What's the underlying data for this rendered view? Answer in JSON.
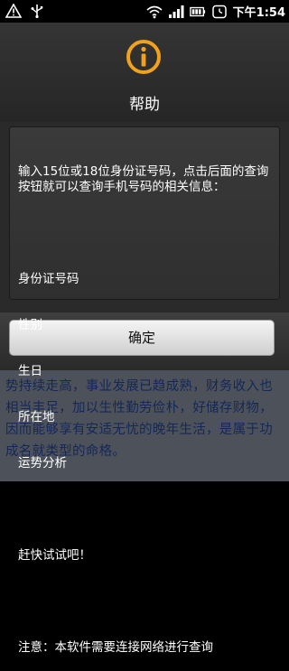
{
  "status_bar": {
    "time": "下午1:54",
    "left_icons": [
      "warning-icon",
      "usb-icon"
    ],
    "right_icons": [
      "wifi-icon",
      "signal-icon",
      "battery-icon",
      "alarm-icon"
    ]
  },
  "background": {
    "text": "爱，而能受到极大的提携与扶持。晚年以后运势持续走高，事业发展已趋成熟，财务收入也相当丰足，加以生性勤劳俭朴，好储存财物，因而能够享有安适无忧的晚年生活，是属于功成名就类型的命格。"
  },
  "dialog": {
    "icon": "info-icon",
    "title": "帮助",
    "message": {
      "intro": "输入15位或18位身份证号码，点击后面的查询按钮就可以查询手机号码的相关信息：",
      "items": [
        "身份证号码",
        "性别",
        "生日",
        "所在地",
        "运势分析"
      ],
      "cta": "赶快试试吧！",
      "note": "注意：本软件需要连接网络进行查询"
    },
    "ok_label": "确定"
  },
  "colors": {
    "icon_accent": "#f2a11a",
    "bg_text": "#2b4fb0"
  }
}
